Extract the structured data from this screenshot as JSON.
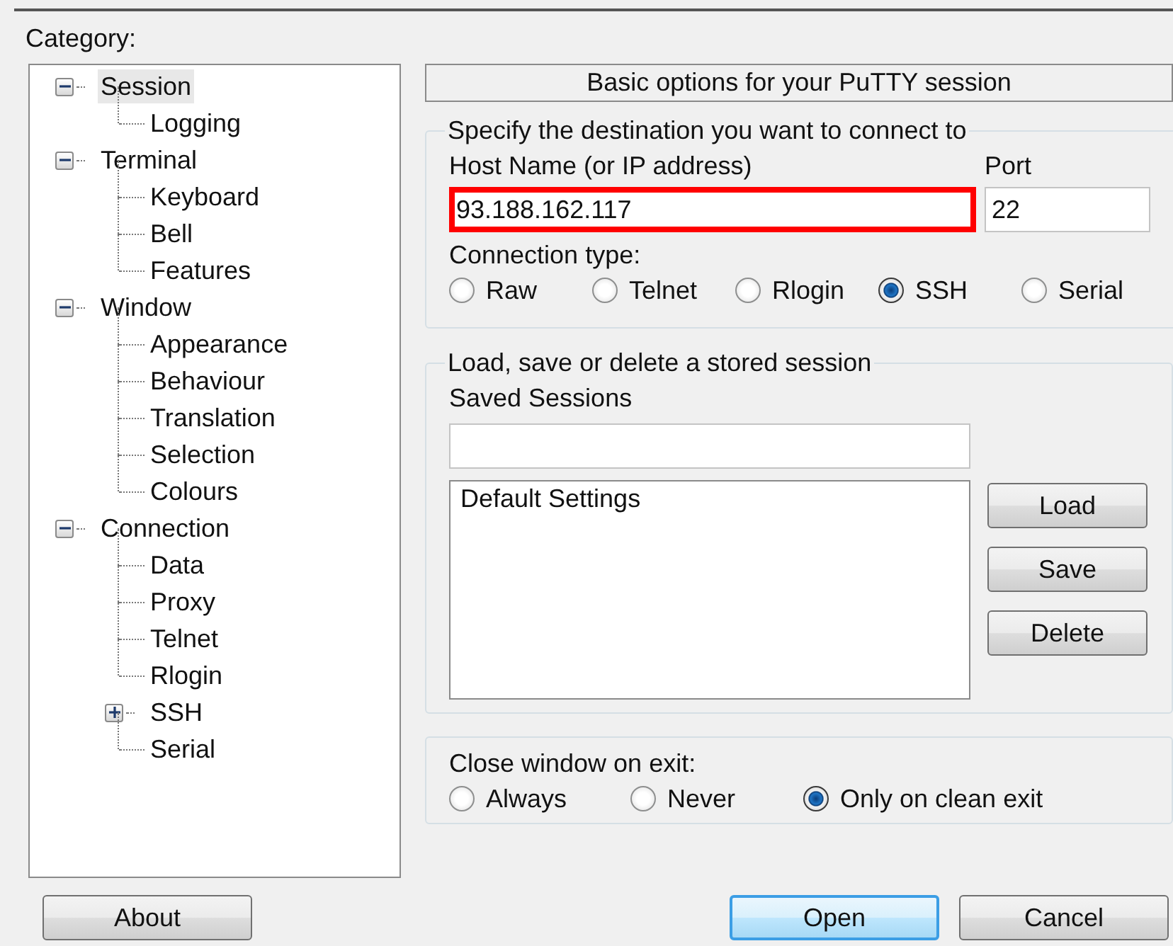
{
  "category_label": "Category:",
  "tree": [
    {
      "label": "Session",
      "selected": true,
      "expanded": true,
      "children": [
        {
          "label": "Logging",
          "selected": false
        }
      ]
    },
    {
      "label": "Terminal",
      "selected": false,
      "expanded": true,
      "children": [
        {
          "label": "Keyboard",
          "selected": false
        },
        {
          "label": "Bell",
          "selected": false
        },
        {
          "label": "Features",
          "selected": false
        }
      ]
    },
    {
      "label": "Window",
      "selected": false,
      "expanded": true,
      "children": [
        {
          "label": "Appearance",
          "selected": false
        },
        {
          "label": "Behaviour",
          "selected": false
        },
        {
          "label": "Translation",
          "selected": false
        },
        {
          "label": "Selection",
          "selected": false
        },
        {
          "label": "Colours",
          "selected": false
        }
      ]
    },
    {
      "label": "Connection",
      "selected": false,
      "expanded": true,
      "children": [
        {
          "label": "Data",
          "selected": false
        },
        {
          "label": "Proxy",
          "selected": false
        },
        {
          "label": "Telnet",
          "selected": false
        },
        {
          "label": "Rlogin",
          "selected": false
        },
        {
          "label": "SSH",
          "selected": false,
          "expanded": false
        },
        {
          "label": "Serial",
          "selected": false
        }
      ]
    }
  ],
  "header": "Basic options for your PuTTY session",
  "destination": {
    "legend": "Specify the destination you want to connect to",
    "host_label": "Host Name (or IP address)",
    "host_value": "93.188.162.117",
    "host_highlighted": true,
    "port_label": "Port",
    "port_value": "22",
    "connection_type_label": "Connection type:",
    "connection_types": [
      {
        "label": "Raw",
        "selected": false
      },
      {
        "label": "Telnet",
        "selected": false
      },
      {
        "label": "Rlogin",
        "selected": false
      },
      {
        "label": "SSH",
        "selected": true
      },
      {
        "label": "Serial",
        "selected": false
      }
    ]
  },
  "sessions": {
    "legend": "Load, save or delete a stored session",
    "saved_label": "Saved Sessions",
    "list": [
      {
        "label": "Default Settings",
        "selected": false
      }
    ],
    "buttons": [
      "Load",
      "Save",
      "Delete"
    ]
  },
  "close": {
    "label": "Close window on exit:",
    "options": [
      {
        "label": "Always",
        "selected": false
      },
      {
        "label": "Never",
        "selected": false
      },
      {
        "label": "Only on clean exit",
        "selected": true
      }
    ]
  },
  "about_button": "About",
  "actions": [
    {
      "label": "Open",
      "default": true
    },
    {
      "label": "Cancel",
      "default": false
    }
  ]
}
